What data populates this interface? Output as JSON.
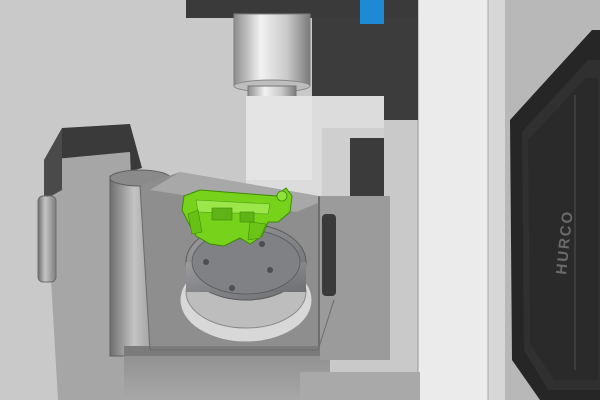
{
  "scene": {
    "machine_brand": "HURCO",
    "colors": {
      "background": "#c9c9c9",
      "machine_dark": "#3b3b3b",
      "machine_light": "#e9e9e9",
      "machine_mid": "#9c9c9c",
      "table_grey": "#8a8c8f",
      "workpiece_green": "#7ed321",
      "status_blue": "#1e8ad6"
    },
    "icons": [
      "spindle-head-icon",
      "cutting-tool-icon",
      "trunnion-table-icon",
      "rotary-platter-icon",
      "workpiece-icon",
      "enclosure-door-icon"
    ]
  }
}
